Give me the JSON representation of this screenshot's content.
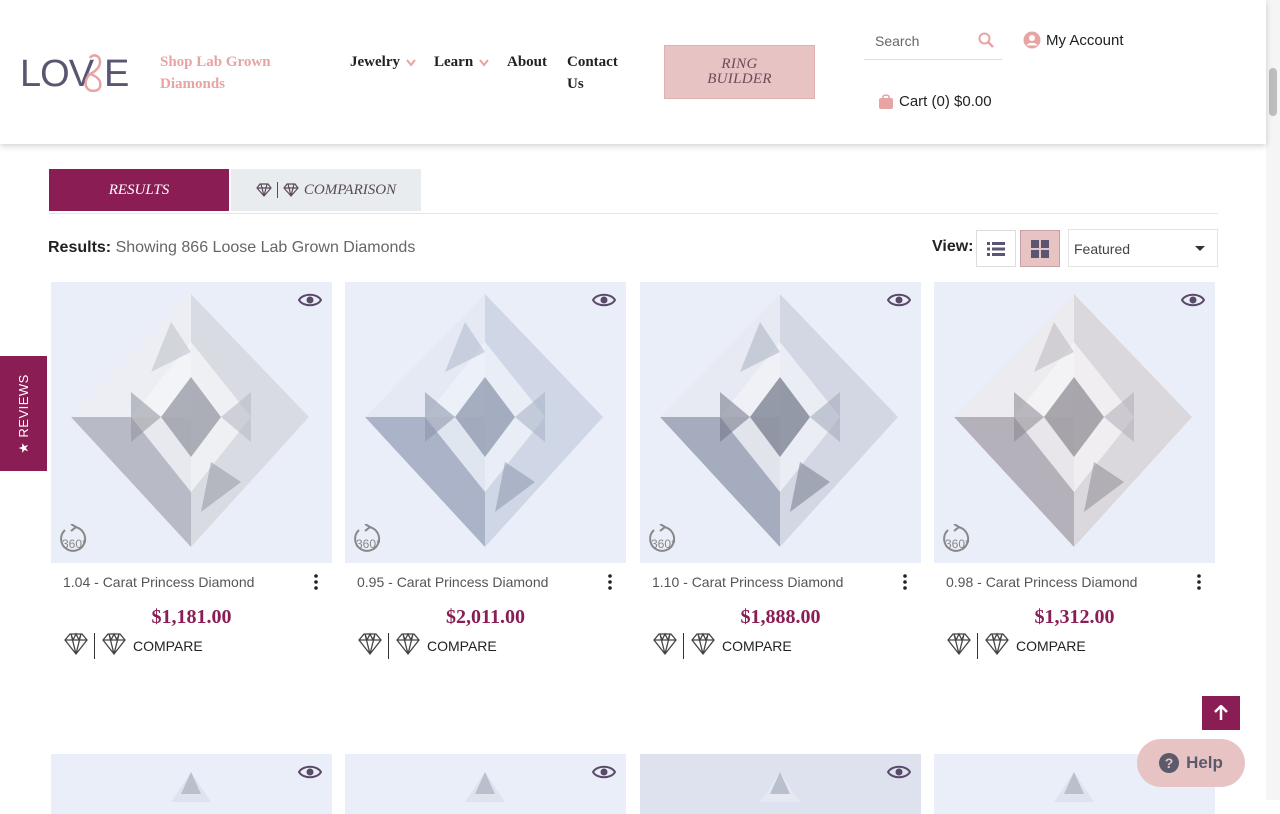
{
  "header": {
    "logo_text": "LOVBE",
    "tagline": "Shop Lab Grown Diamonds",
    "nav": [
      {
        "label": "Jewelry",
        "has_dropdown": true
      },
      {
        "label": "Learn",
        "has_dropdown": true
      },
      {
        "label": "About",
        "has_dropdown": false
      },
      {
        "label": "Contact Us",
        "has_dropdown": false
      }
    ],
    "ring_builder": "RING BUILDER",
    "search_placeholder": "Search",
    "account_label": "My Account",
    "cart_label": "Cart (0) $0.00"
  },
  "tabs": {
    "results": "RESULTS",
    "comparison": "COMPARISON"
  },
  "results": {
    "label": "Results:",
    "text": "Showing 866 Loose Lab Grown Diamonds"
  },
  "view": {
    "label": "View:",
    "active": "grid",
    "sort_selected": "Featured"
  },
  "reviews_tab": "★ REVIEWS",
  "products": [
    {
      "title": "1.04 - Carat Princess Diamond",
      "price": "$1,181.00",
      "compare_label": "COMPARE",
      "badge_360": "360°"
    },
    {
      "title": "0.95 - Carat Princess Diamond",
      "price": "$2,011.00",
      "compare_label": "COMPARE",
      "badge_360": "360°"
    },
    {
      "title": "1.10 - Carat Princess Diamond",
      "price": "$1,888.00",
      "compare_label": "COMPARE",
      "badge_360": "360°"
    },
    {
      "title": "0.98 - Carat Princess Diamond",
      "price": "$1,312.00",
      "compare_label": "COMPARE",
      "badge_360": "360°"
    }
  ],
  "help_label": "Help",
  "colors": {
    "brand": "#8b1d55",
    "accent_pink": "#e8c3c3",
    "tagline_pink": "#e8a3a3"
  },
  "icons": [
    "search-icon",
    "user-icon",
    "cart-icon",
    "chevron-down-icon",
    "diamond-icon",
    "list-view-icon",
    "grid-view-icon",
    "eye-icon",
    "rotate-360-icon",
    "kebab-menu-icon",
    "arrow-up-icon",
    "help-icon"
  ]
}
